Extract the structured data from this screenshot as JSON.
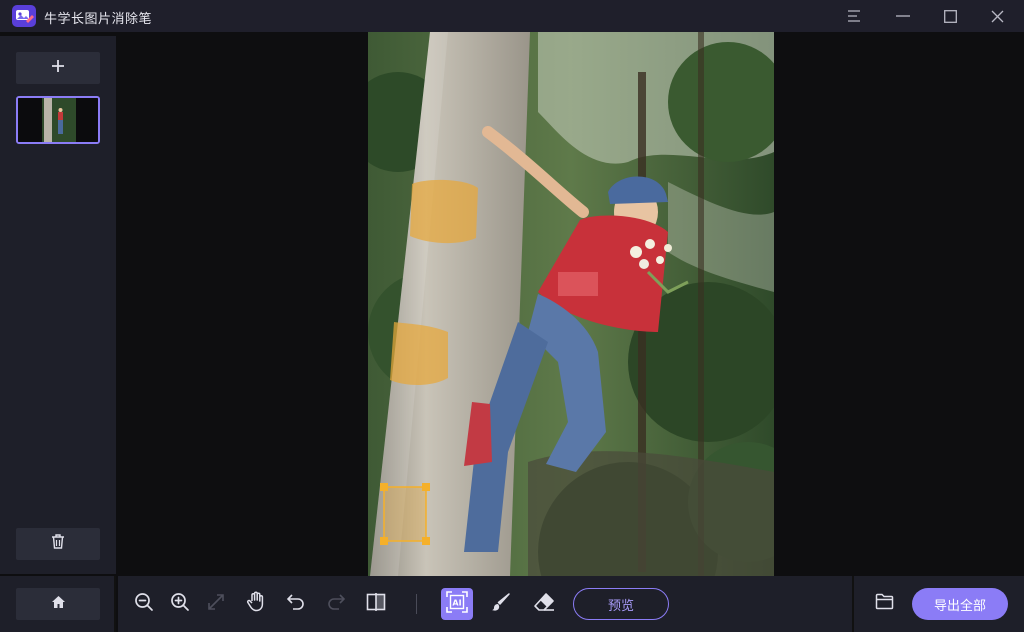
{
  "app": {
    "title": "牛学长图片消除笔",
    "brand_color": "#8b7cf6"
  },
  "window_controls": {
    "icons": [
      "menu-icon",
      "minimize-icon",
      "maximize-icon",
      "close-icon"
    ]
  },
  "sidebar": {
    "add_icon": "plus-icon",
    "delete_icon": "trash-icon",
    "home_icon": "home-icon",
    "thumbnails": [
      {
        "selected": true
      }
    ]
  },
  "toolbar": {
    "tools": [
      "zoom-out-icon",
      "zoom-in-icon",
      "fit-screen-icon",
      "hand-pan-icon",
      "undo-icon",
      "redo-icon",
      "compare-icon",
      "ai-select-icon",
      "brush-icon",
      "eraser-icon"
    ],
    "active_tool": "ai-select-icon",
    "preview_label": "预览",
    "export_label": "导出全部",
    "folder_icon": "folder-icon"
  }
}
